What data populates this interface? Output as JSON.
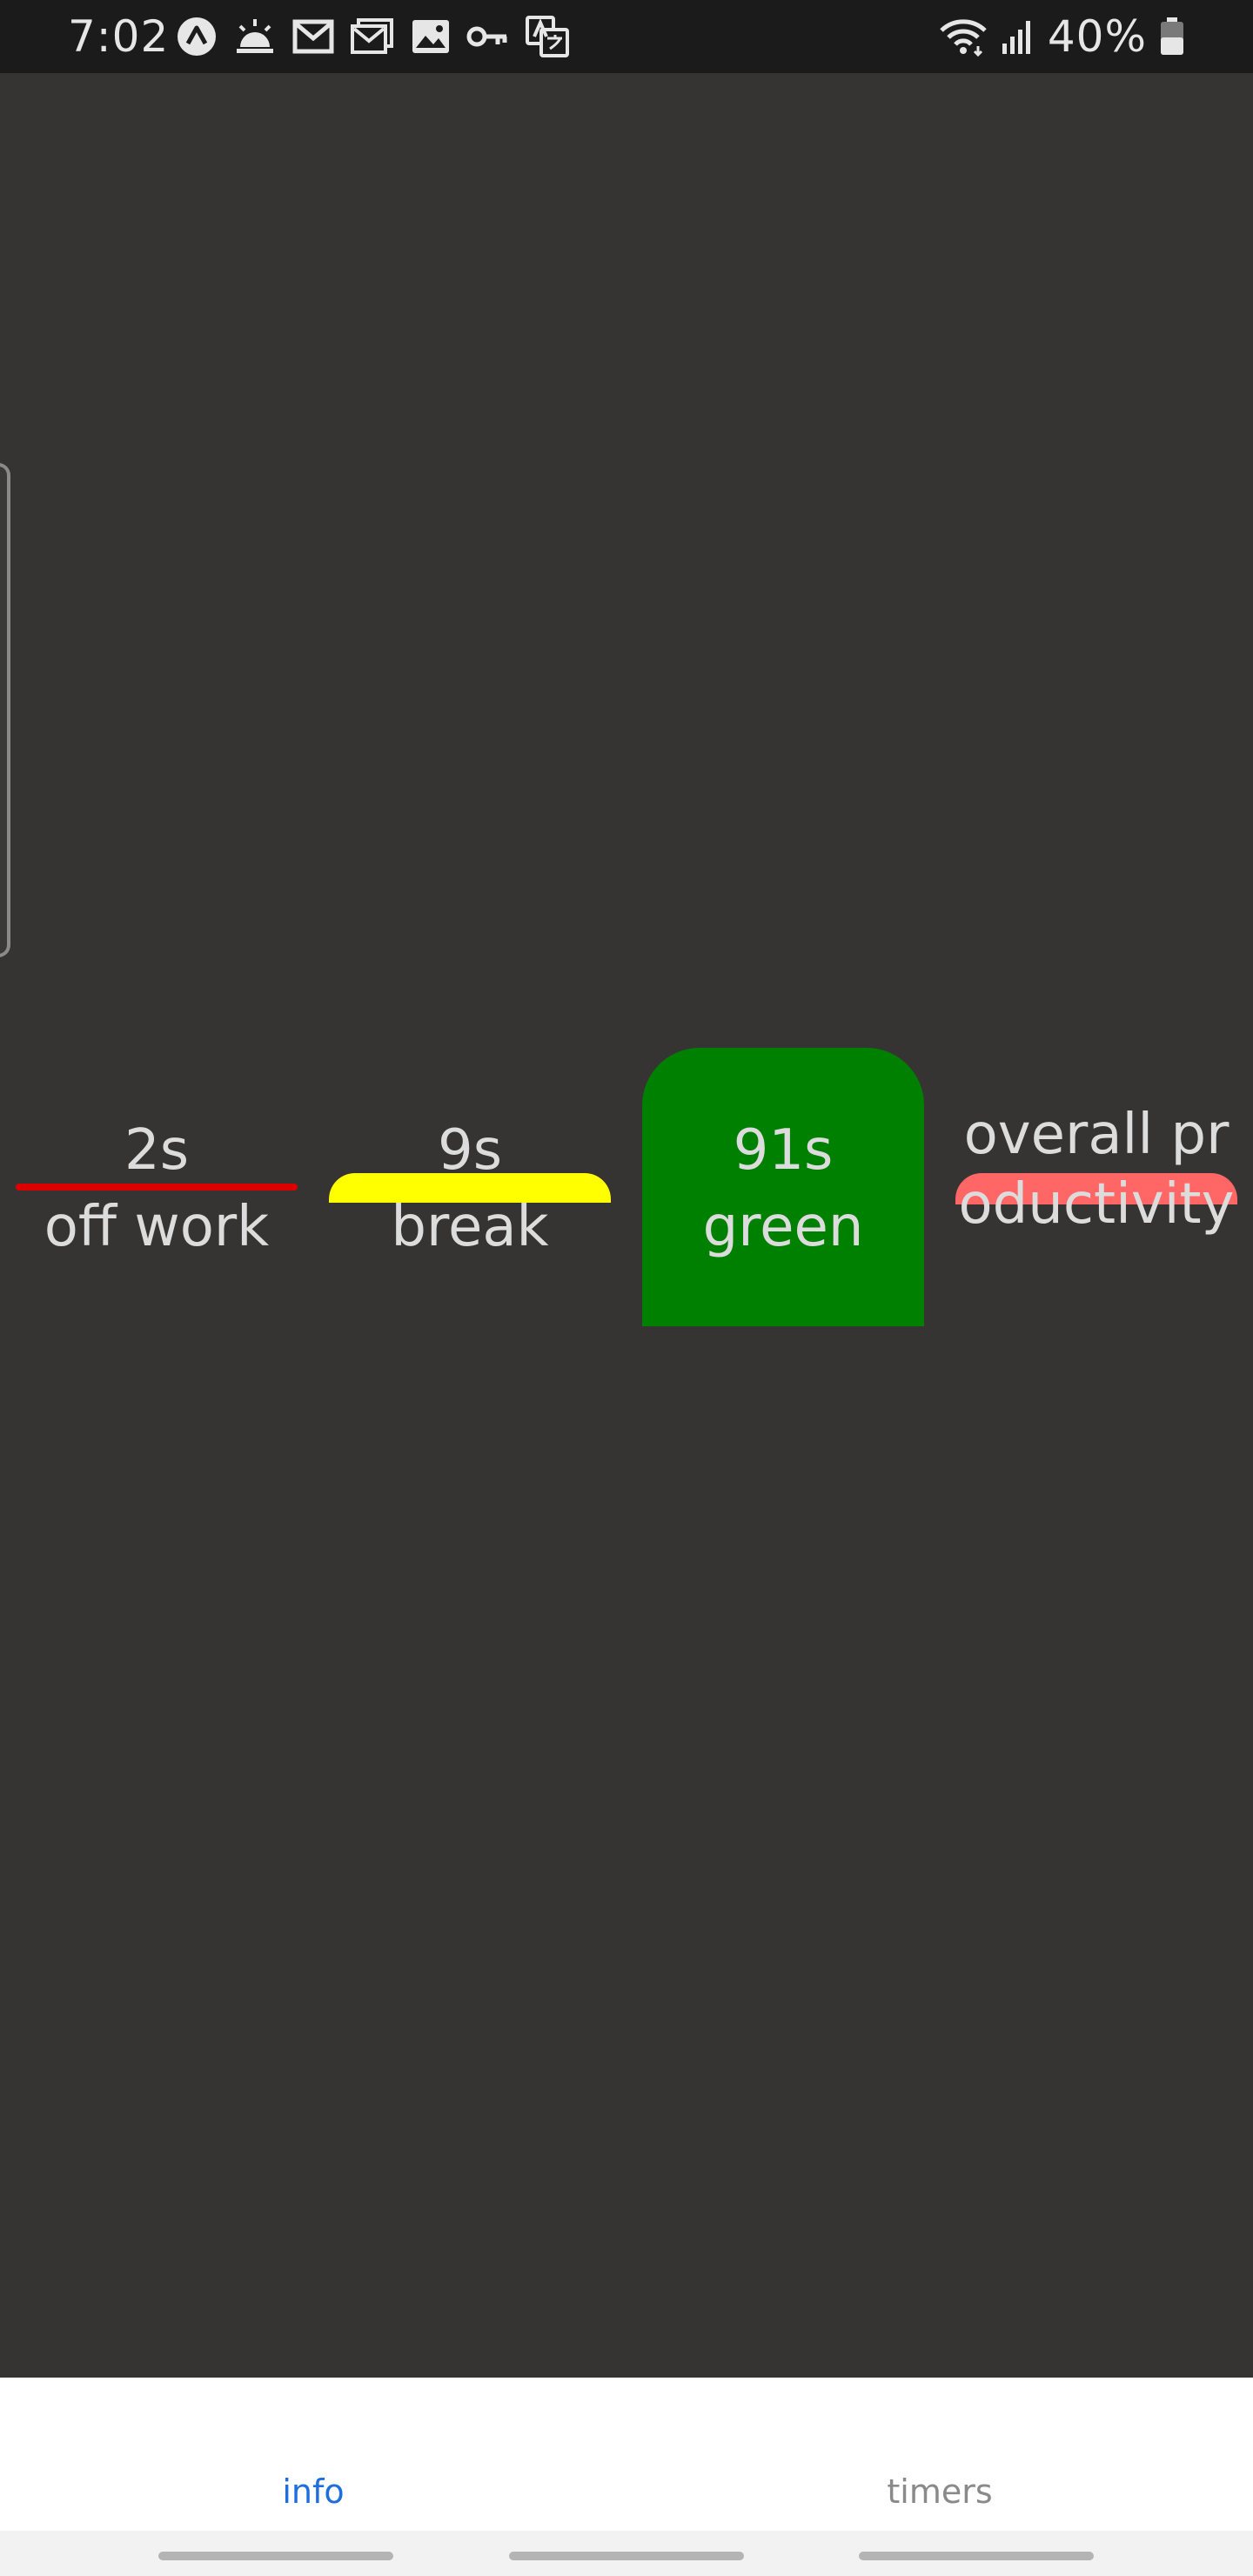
{
  "status_bar": {
    "time": "7:02",
    "battery": "40%",
    "left_icons": [
      "app-a-icon",
      "weather-sunrise-icon",
      "gmail-icon",
      "gmail-icon",
      "gallery-icon",
      "key-icon",
      "translate-icon"
    ],
    "right_icons": [
      "wifi-icon",
      "signal-icon",
      "battery-icon"
    ]
  },
  "stats": [
    {
      "value": "2s",
      "label": "off work",
      "color": "#dd0000"
    },
    {
      "value": "9s",
      "label": "break",
      "color": "#ffff00"
    },
    {
      "value": "91s",
      "label": "green",
      "color": "#008000"
    },
    {
      "value": "overall productivity",
      "label": "",
      "color": "#ff6666"
    }
  ],
  "nav": {
    "tabs": [
      {
        "label": "info",
        "active": true
      },
      {
        "label": "timers",
        "active": false
      }
    ]
  }
}
